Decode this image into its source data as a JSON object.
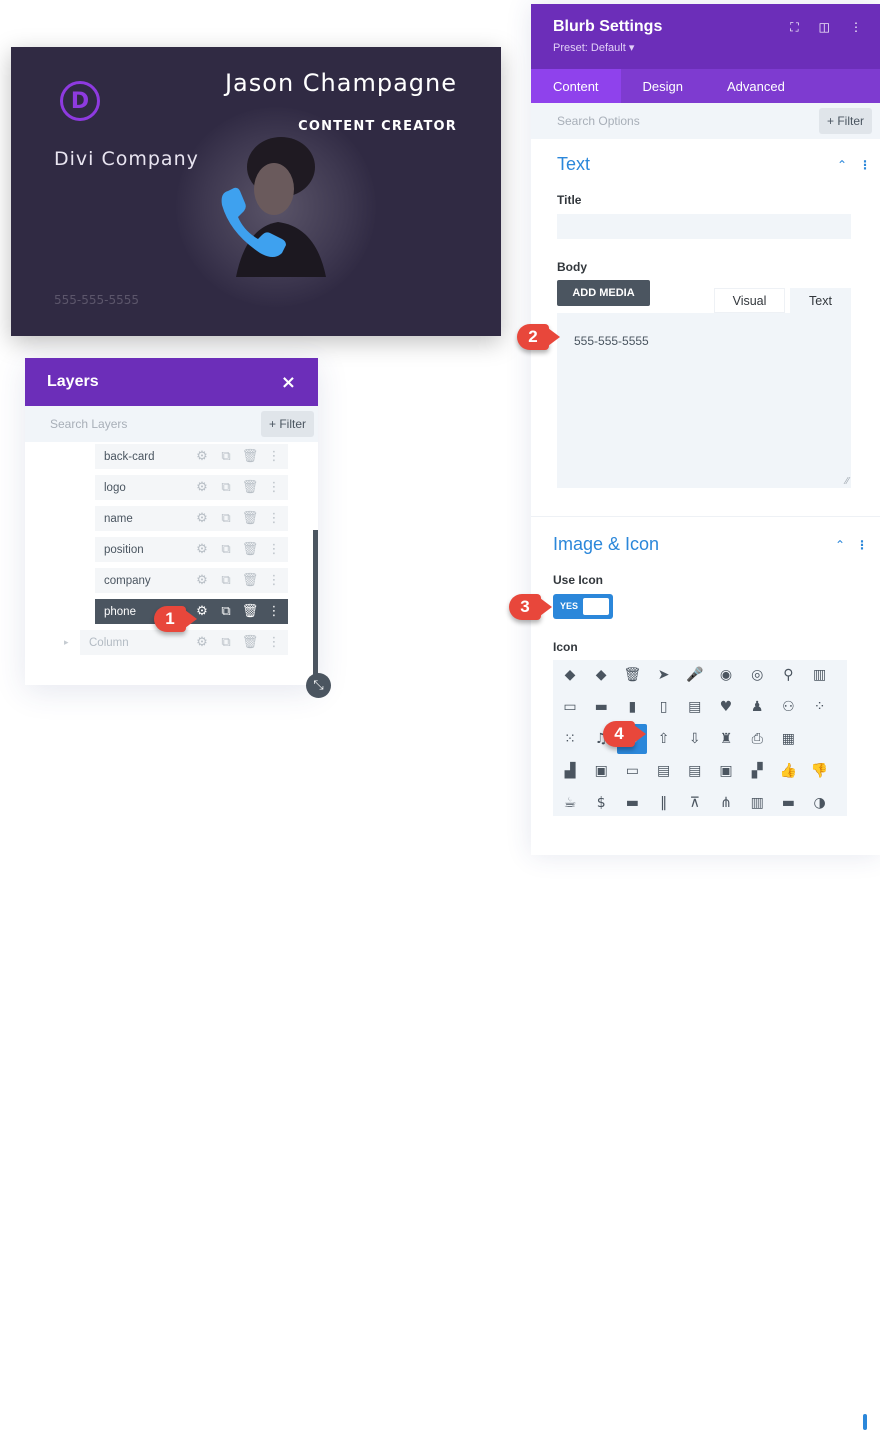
{
  "card": {
    "logo_letter": "D",
    "name": "Jason Champagne",
    "position": "CONTENT CREATOR",
    "company": "Divi Company",
    "phone": "555-555-5555",
    "colors": {
      "background": "#302a43",
      "logo": "#8e3ae0",
      "phone_icon": "#3ea1ef"
    }
  },
  "layers": {
    "title": "Layers",
    "close_icon": "×",
    "search_placeholder": "Search Layers",
    "filter_label": "+ Filter",
    "items": [
      {
        "label": "back-card",
        "active": false
      },
      {
        "label": "logo",
        "active": false
      },
      {
        "label": "name",
        "active": false
      },
      {
        "label": "position",
        "active": false
      },
      {
        "label": "company",
        "active": false
      },
      {
        "label": "phone",
        "active": true
      },
      {
        "label": "Column",
        "active": false,
        "collapsed": true
      }
    ]
  },
  "settings": {
    "title": "Blurb Settings",
    "preset": "Preset: Default ▾",
    "tabs": [
      {
        "label": "Content",
        "active": true
      },
      {
        "label": "Design",
        "active": false
      },
      {
        "label": "Advanced",
        "active": false
      }
    ],
    "search_placeholder": "Search Options",
    "filter_label": "+ Filter",
    "text_section": {
      "title": "Text",
      "title_label": "Title",
      "title_value": "",
      "body_label": "Body",
      "add_media_label": "ADD MEDIA",
      "editor_tabs": [
        "Visual",
        "Text"
      ],
      "body_value": "555-555-5555"
    },
    "image_icon_section": {
      "title": "Image & Icon",
      "use_icon_label": "Use Icon",
      "use_icon_value": "YES",
      "icon_label": "Icon",
      "selected_icon": "phone"
    },
    "accent_color": "#2b87da",
    "header_color": "#6c2eb9"
  },
  "icon_grid": [
    [
      "tag",
      "tags",
      "trash",
      "cursor",
      "microphone",
      "compass",
      "map-pin",
      "pin",
      "books"
    ],
    [
      "inbox",
      "toolbox",
      "book",
      "address-book",
      "archive",
      "heart",
      "user",
      "users",
      "grid-4"
    ],
    [
      "grid-9",
      "music",
      "phone",
      "upload",
      "download",
      "chess-rook",
      "printer",
      "calculator",
      ""
    ],
    [
      "building",
      "save",
      "laptop",
      "document-search",
      "id-card",
      "id-badge",
      "puzzle",
      "thumbs-up",
      "thumbs-down"
    ],
    [
      "coffee",
      "dollar",
      "wallet",
      "tools",
      "presentation",
      "sitemap",
      "bar-chart",
      "briefcase",
      "pie-chart"
    ]
  ],
  "icon_glyphs": [
    [
      "◆",
      "◆",
      "🗑",
      "➤",
      "🎤",
      "◉",
      "◎",
      "⚲",
      "▥"
    ],
    [
      "▭",
      "▬",
      "▮",
      "▯",
      "▤",
      "♥",
      "♟",
      "⚇",
      "⁘"
    ],
    [
      "⁙",
      "♫",
      "✆",
      "⇧",
      "⇩",
      "♜",
      "⎙",
      "▦",
      ""
    ],
    [
      "▟",
      "▣",
      "▭",
      "▤",
      "▤",
      "▣",
      "▞",
      "👍",
      "👎"
    ],
    [
      "☕",
      "$",
      "▬",
      "‖",
      "⊼",
      "⋔",
      "▥",
      "▬",
      "◑"
    ]
  ],
  "callouts": [
    "1",
    "2",
    "3",
    "4"
  ]
}
